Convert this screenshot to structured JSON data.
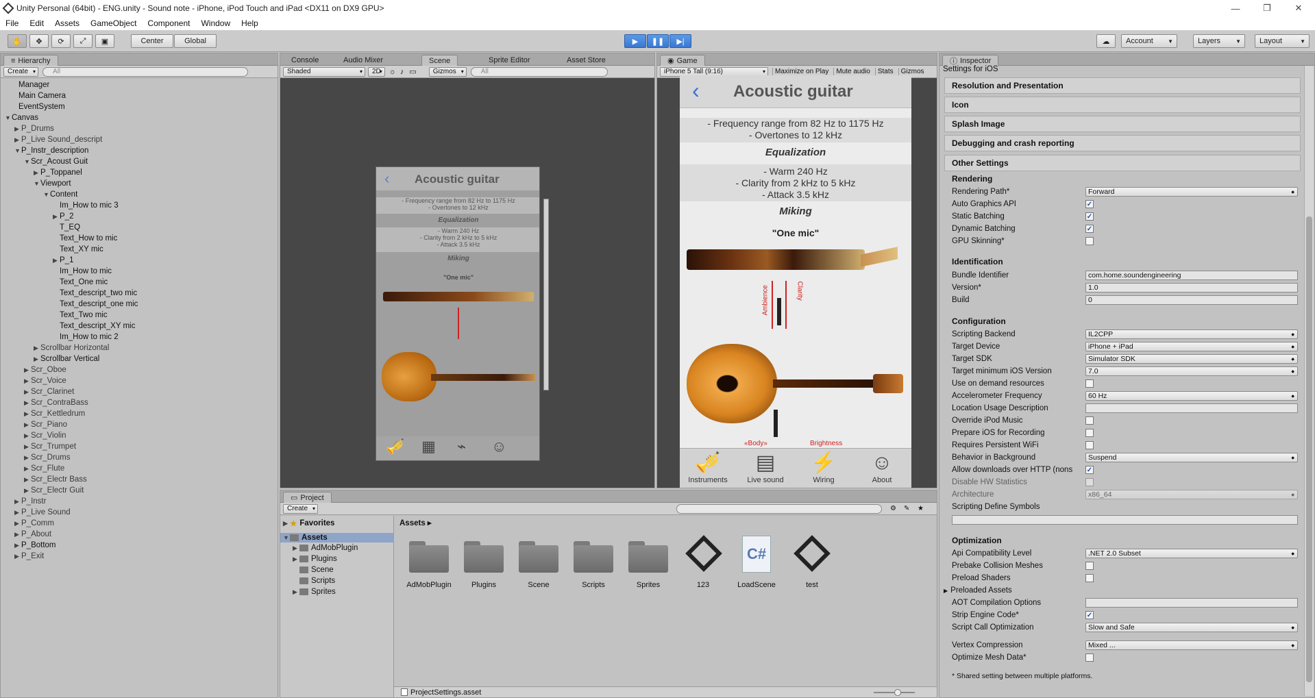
{
  "window": {
    "title": "Unity Personal (64bit) - ENG.unity - Sound note - iPhone, iPod Touch and iPad <DX11 on DX9 GPU>"
  },
  "menu": [
    "File",
    "Edit",
    "Assets",
    "GameObject",
    "Component",
    "Window",
    "Help"
  ],
  "toolbar": {
    "center": "Center",
    "global": "Global",
    "account": "Account",
    "layers": "Layers",
    "layout": "Layout"
  },
  "hierarchy": {
    "tab": "Hierarchy",
    "create": "Create",
    "search_placeholder": "All",
    "items": [
      {
        "label": "Manager",
        "depth": 0,
        "arrow": ""
      },
      {
        "label": "Main Camera",
        "depth": 0,
        "arrow": ""
      },
      {
        "label": "EventSystem",
        "depth": 0,
        "arrow": ""
      },
      {
        "label": "Canvas",
        "depth": 0,
        "arrow": "▼"
      },
      {
        "label": "P_Drums",
        "depth": 1,
        "arrow": "▶",
        "dim": true
      },
      {
        "label": "P_Live Sound_descript",
        "depth": 1,
        "arrow": "▶",
        "dim": true
      },
      {
        "label": "P_Instr_description",
        "depth": 1,
        "arrow": "▼"
      },
      {
        "label": "Scr_Acoust Guit",
        "depth": 2,
        "arrow": "▼"
      },
      {
        "label": "P_Toppanel",
        "depth": 3,
        "arrow": "▶"
      },
      {
        "label": "Viewport",
        "depth": 3,
        "arrow": "▼"
      },
      {
        "label": "Content",
        "depth": 4,
        "arrow": "▼"
      },
      {
        "label": "Im_How to mic 3",
        "depth": 5,
        "arrow": ""
      },
      {
        "label": "P_2",
        "depth": 5,
        "arrow": "▶"
      },
      {
        "label": "T_EQ",
        "depth": 5,
        "arrow": ""
      },
      {
        "label": "Text_How to mic",
        "depth": 5,
        "arrow": ""
      },
      {
        "label": "Text_XY mic",
        "depth": 5,
        "arrow": ""
      },
      {
        "label": "P_1",
        "depth": 5,
        "arrow": "▶"
      },
      {
        "label": "Im_How to mic",
        "depth": 5,
        "arrow": ""
      },
      {
        "label": "Text_One mic",
        "depth": 5,
        "arrow": ""
      },
      {
        "label": "Text_descript_two mic",
        "depth": 5,
        "arrow": ""
      },
      {
        "label": "Text_descript_one mic",
        "depth": 5,
        "arrow": ""
      },
      {
        "label": "Text_Two mic",
        "depth": 5,
        "arrow": ""
      },
      {
        "label": "Text_descript_XY mic",
        "depth": 5,
        "arrow": ""
      },
      {
        "label": "Im_How to mic 2",
        "depth": 5,
        "arrow": ""
      },
      {
        "label": "Scrollbar Horizontal",
        "depth": 3,
        "arrow": "▶",
        "dim": true
      },
      {
        "label": "Scrollbar Vertical",
        "depth": 3,
        "arrow": "▶"
      },
      {
        "label": "Scr_Oboe",
        "depth": 2,
        "arrow": "▶",
        "dim": true
      },
      {
        "label": "Scr_Voice",
        "depth": 2,
        "arrow": "▶",
        "dim": true
      },
      {
        "label": "Scr_Clarinet",
        "depth": 2,
        "arrow": "▶",
        "dim": true
      },
      {
        "label": "Scr_ContraBass",
        "depth": 2,
        "arrow": "▶",
        "dim": true
      },
      {
        "label": "Scr_Kettledrum",
        "depth": 2,
        "arrow": "▶",
        "dim": true
      },
      {
        "label": "Scr_Piano",
        "depth": 2,
        "arrow": "▶",
        "dim": true
      },
      {
        "label": "Scr_Violin",
        "depth": 2,
        "arrow": "▶",
        "dim": true
      },
      {
        "label": "Scr_Trumpet",
        "depth": 2,
        "arrow": "▶",
        "dim": true
      },
      {
        "label": "Scr_Drums",
        "depth": 2,
        "arrow": "▶",
        "dim": true
      },
      {
        "label": "Scr_Flute",
        "depth": 2,
        "arrow": "▶",
        "dim": true
      },
      {
        "label": "Scr_Electr Bass",
        "depth": 2,
        "arrow": "▶",
        "dim": true
      },
      {
        "label": "Scr_Electr Guit",
        "depth": 2,
        "arrow": "▶",
        "dim": true
      },
      {
        "label": "P_Instr",
        "depth": 1,
        "arrow": "▶",
        "dim": true
      },
      {
        "label": "P_Live Sound",
        "depth": 1,
        "arrow": "▶",
        "dim": true
      },
      {
        "label": "P_Comm",
        "depth": 1,
        "arrow": "▶",
        "dim": true
      },
      {
        "label": "P_About",
        "depth": 1,
        "arrow": "▶",
        "dim": true
      },
      {
        "label": "P_Bottom",
        "depth": 1,
        "arrow": "▶"
      },
      {
        "label": "P_Exit",
        "depth": 1,
        "arrow": "▶",
        "dim": true
      }
    ]
  },
  "center_tabs": [
    "Console",
    "Audio Mixer",
    "Scene",
    "Sprite Editor",
    "Asset Store"
  ],
  "scene": {
    "shaded": "Shaded",
    "mode2d": "2D",
    "gizmos": "Gizmos",
    "search_placeholder": "All"
  },
  "game": {
    "tab": "Game",
    "aspect": "iPhone 5 Tall (9:16)",
    "maximize": "Maximize on Play",
    "mute": "Mute audio",
    "stats": "Stats",
    "gizmos": "Gizmos"
  },
  "app": {
    "title": "Acoustic guitar",
    "freq1": "- Frequency range from 82 Hz to 1175 Hz",
    "freq2": "- Overtones to 12 kHz",
    "eq_head": "Equalization",
    "eq1": "- Warm 240 Hz",
    "eq2": "- Clarity from 2 kHz to 5 kHz",
    "eq3": "- Attack 3.5 kHz",
    "miking": "Miking",
    "one_mic": "\"One mic\"",
    "ambience": "Ambience",
    "clarity": "Clarity",
    "body": "«Body»",
    "brightness": "Brightness",
    "nav": [
      "Instruments",
      "Live sound",
      "Wiring",
      "About"
    ]
  },
  "project": {
    "tab": "Project",
    "create": "Create",
    "favorites": "Favorites",
    "assets": "Assets",
    "folders": [
      "AdMobPlugin",
      "Plugins",
      "Scene",
      "Scripts",
      "Sprites"
    ],
    "grid_items": [
      "AdMobPlugin",
      "Plugins",
      "Scene",
      "Scripts",
      "Sprites",
      "123",
      "LoadScene",
      "test"
    ],
    "status_file": "ProjectSettings.asset"
  },
  "inspector": {
    "tab": "Inspector",
    "heading": "Settings for iOS",
    "sections": [
      "Resolution and Presentation",
      "Icon",
      "Splash Image",
      "Debugging and crash reporting"
    ],
    "other": "Other Settings",
    "rendering": "Rendering",
    "rendering_path_label": "Rendering Path*",
    "rendering_path": "Forward",
    "auto_gfx": "Auto Graphics API",
    "static_batch": "Static Batching",
    "dynamic_batch": "Dynamic Batching",
    "gpu_skin": "GPU Skinning*",
    "identification": "Identification",
    "bundle_label": "Bundle Identifier",
    "bundle": "com.home.soundengineering",
    "version_label": "Version*",
    "version": "1.0",
    "build_label": "Build",
    "build": "0",
    "configuration": "Configuration",
    "backend_label": "Scripting Backend",
    "backend": "IL2CPP",
    "device_label": "Target Device",
    "device": "iPhone + iPad",
    "sdk_label": "Target SDK",
    "sdk": "Simulator SDK",
    "minios_label": "Target minimum iOS Version",
    "minios": "7.0",
    "ondemand": "Use on demand resources",
    "accel_label": "Accelerometer Frequency",
    "accel": "60 Hz",
    "location": "Location Usage Description",
    "override": "Override iPod Music",
    "prepare": "Prepare iOS for Recording",
    "wifi": "Requires Persistent WiFi",
    "bg_label": "Behavior in Background",
    "bg": "Suspend",
    "allow": "Allow downloads over HTTP (nons",
    "hwstats": "Disable HW Statistics",
    "arch_label": "Architecture",
    "arch": "x86_64",
    "define": "Scripting Define Symbols",
    "optimization": "Optimization",
    "api_label": "Api Compatibility Level",
    "api": ".NET 2.0 Subset",
    "prebake": "Prebake Collision Meshes",
    "preload_shaders": "Preload Shaders",
    "preloaded": "Preloaded Assets",
    "aot": "AOT Compilation Options",
    "strip": "Strip Engine Code*",
    "callopt_label": "Script Call Optimization",
    "callopt": "Slow and Safe",
    "vertex_label": "Vertex Compression",
    "vertex": "Mixed ...",
    "mesh": "Optimize Mesh Data*",
    "footnote": "* Shared setting between multiple platforms."
  }
}
